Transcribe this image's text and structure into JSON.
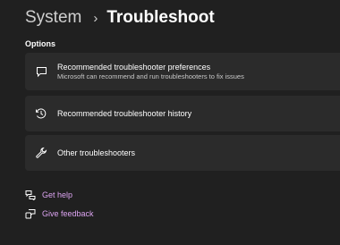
{
  "breadcrumb": {
    "parent": "System",
    "separator": "›",
    "current": "Troubleshoot"
  },
  "section": {
    "label": "Options"
  },
  "cards": [
    {
      "icon": "chat-bubble-icon",
      "title": "Recommended troubleshooter preferences",
      "subtitle": "Microsoft can recommend and run troubleshooters to fix issues"
    },
    {
      "icon": "history-icon",
      "title": "Recommended troubleshooter history"
    },
    {
      "icon": "wrench-icon",
      "title": "Other troubleshooters"
    }
  ],
  "links": [
    {
      "icon": "help-icon",
      "label": "Get help"
    },
    {
      "icon": "feedback-icon",
      "label": "Give feedback"
    }
  ],
  "colors": {
    "background": "#202020",
    "card": "#2b2b2b",
    "link": "#dba3f0"
  }
}
